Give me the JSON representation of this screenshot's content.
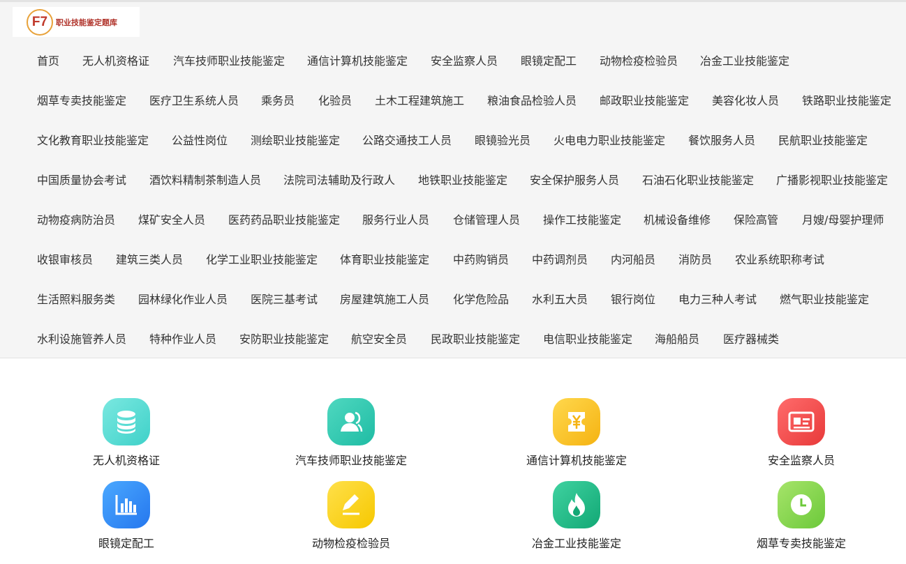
{
  "logo": {
    "mark": "F7",
    "text": "职业技能鉴定题库"
  },
  "nav": {
    "rows": [
      [
        "首页",
        "无人机资格证",
        "汽车技师职业技能鉴定",
        "通信计算机技能鉴定",
        "安全监察人员",
        "眼镜定配工",
        "动物检疫检验员",
        "冶金工业技能鉴定"
      ],
      [
        "烟草专卖技能鉴定",
        "医疗卫生系统人员",
        "乘务员",
        "化验员",
        "土木工程建筑施工",
        "粮油食品检验人员",
        "邮政职业技能鉴定",
        "美容化妆人员",
        "铁路职业技能鉴定"
      ],
      [
        "文化教育职业技能鉴定",
        "公益性岗位",
        "测绘职业技能鉴定",
        "公路交通技工人员",
        "眼镜验光员",
        "火电电力职业技能鉴定",
        "餐饮服务人员",
        "民航职业技能鉴定"
      ],
      [
        "中国质量协会考试",
        "酒饮料精制茶制造人员",
        "法院司法辅助及行政人",
        "地铁职业技能鉴定",
        "安全保护服务人员",
        "石油石化职业技能鉴定",
        "广播影视职业技能鉴定"
      ],
      [
        "动物疫病防治员",
        "煤矿安全人员",
        "医药药品职业技能鉴定",
        "服务行业人员",
        "仓储管理人员",
        "操作工技能鉴定",
        "机械设备维修",
        "保险高管",
        "月嫂/母婴护理师"
      ],
      [
        "收银审核员",
        "建筑三类人员",
        "化学工业职业技能鉴定",
        "体育职业技能鉴定",
        "中药购销员",
        "中药调剂员",
        "内河船员",
        "消防员",
        "农业系统职称考试"
      ],
      [
        "生活照料服务类",
        "园林绿化作业人员",
        "医院三基考试",
        "房屋建筑施工人员",
        "化学危险品",
        "水利五大员",
        "银行岗位",
        "电力三种人考试",
        "燃气职业技能鉴定"
      ],
      [
        "水利设施管养人员",
        "特种作业人员",
        "安防职业技能鉴定",
        "航空安全员",
        "民政职业技能鉴定",
        "电信职业技能鉴定",
        "海船船员",
        "医疗器械类"
      ]
    ]
  },
  "cards": [
    {
      "label": "无人机资格证",
      "icon": "database-icon",
      "color": "#4fd9d0"
    },
    {
      "label": "汽车技师职业技能鉴定",
      "icon": "user-icon",
      "color": "#22c2aa"
    },
    {
      "label": "通信计算机技能鉴定",
      "icon": "yen-ticket-icon",
      "color": "#f7bd1f"
    },
    {
      "label": "安全监察人员",
      "icon": "id-card-icon",
      "color": "#ee4545"
    },
    {
      "label": "眼镜定配工",
      "icon": "bar-chart-icon",
      "color": "#2f86f2"
    },
    {
      "label": "动物检疫检验员",
      "icon": "edit-icon",
      "color": "#f8cf10"
    },
    {
      "label": "冶金工业技能鉴定",
      "icon": "flame-icon",
      "color": "#1cb47f"
    },
    {
      "label": "烟草专卖技能鉴定",
      "icon": "clock-icon",
      "color": "#7ccf44"
    }
  ]
}
